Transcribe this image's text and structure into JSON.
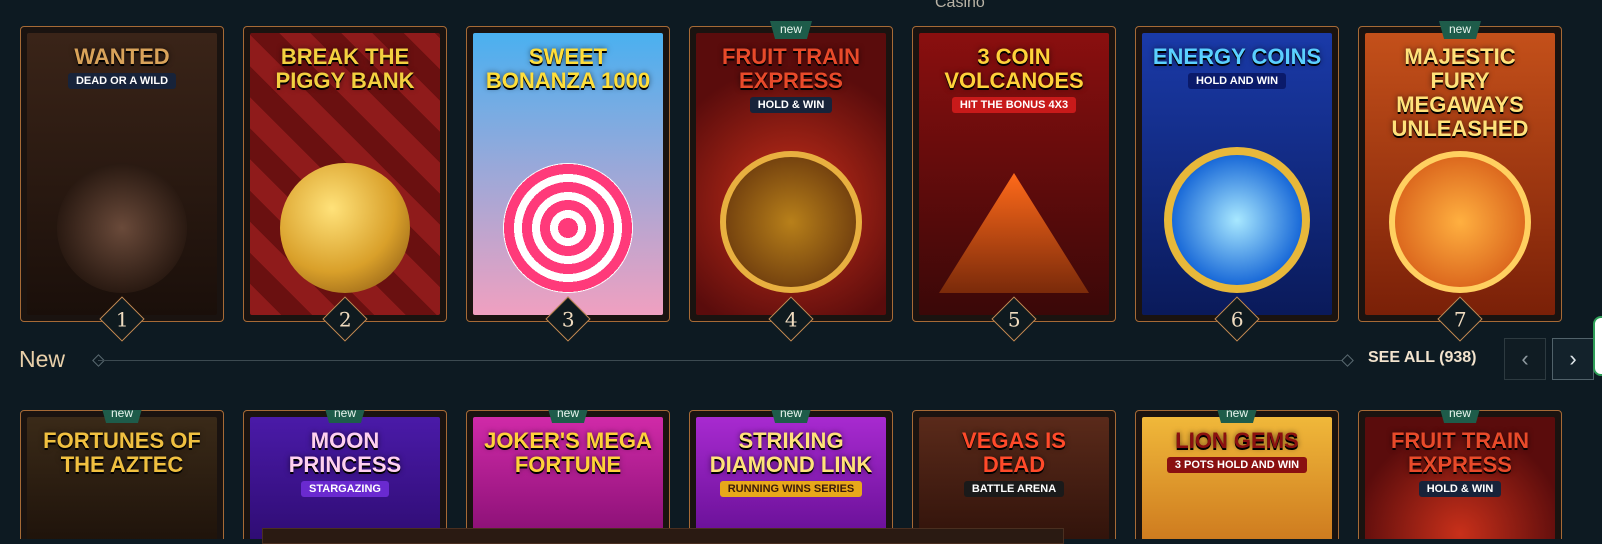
{
  "header": {
    "label": "Casino"
  },
  "top_games": [
    {
      "title": "Wanted",
      "subtitle": "Dead or a Wild",
      "rank": "1",
      "new": "",
      "bg": "#3a2418",
      "accent": "#c58a3a"
    },
    {
      "title": "Break the Piggy Bank",
      "subtitle": "",
      "rank": "2",
      "new": "",
      "bg": "#8f1b1b",
      "accent": "#e0b03a"
    },
    {
      "title": "Sweet Bonanza 1000",
      "subtitle": "",
      "rank": "3",
      "new": "",
      "bg": "#3aa0e8",
      "accent": "#e83a7a"
    },
    {
      "title": "Fruit Train Express",
      "subtitle": "Hold & Win",
      "rank": "4",
      "new": "new",
      "bg": "#5a0c0c",
      "accent": "#d9a13a"
    },
    {
      "title": "3 Coin Volcanoes",
      "subtitle": "Hit the Bonus 4x3",
      "rank": "5",
      "new": "",
      "bg": "#7a0f0f",
      "accent": "#e84a1a"
    },
    {
      "title": "Energy Coins",
      "subtitle": "Hold and Win",
      "rank": "6",
      "new": "",
      "bg": "#1a3aa8",
      "accent": "#e8b83a"
    },
    {
      "title": "Majestic Fury Megaways Unleashed",
      "subtitle": "",
      "rank": "7",
      "new": "new",
      "bg": "#c4501a",
      "accent": "#f0b040"
    }
  ],
  "new_section": {
    "title": "New",
    "see_all": "SEE ALL (938)",
    "prev_icon": "‹",
    "next_icon": "›",
    "games": [
      {
        "title": "Fortunes of the Aztec",
        "subtitle": "",
        "new": "new",
        "bg": "#2a1a10",
        "accent": "#e0b040"
      },
      {
        "title": "Moon Princess",
        "subtitle": "Stargazing",
        "new": "new",
        "bg": "#3a1a8a",
        "accent": "#f07ad0"
      },
      {
        "title": "Joker's Mega Fortune",
        "subtitle": "",
        "new": "new",
        "bg": "#b81a8a",
        "accent": "#f0c040"
      },
      {
        "title": "Striking Diamond Link",
        "subtitle": "Running Wins Series",
        "new": "new",
        "bg": "#9a1ab8",
        "accent": "#3ad0f0"
      },
      {
        "title": "Vegas is Dead",
        "subtitle": "Battle Arena",
        "new": "",
        "bg": "#3a1a10",
        "accent": "#e83a3a"
      },
      {
        "title": "Lion Gems",
        "subtitle": "3 Pots Hold and Win",
        "new": "new",
        "bg": "#e8a81a",
        "accent": "#b81a1a"
      },
      {
        "title": "Fruit Train Express",
        "subtitle": "Hold & Win",
        "new": "new",
        "bg": "#5a0c0c",
        "accent": "#d9a13a"
      }
    ]
  }
}
